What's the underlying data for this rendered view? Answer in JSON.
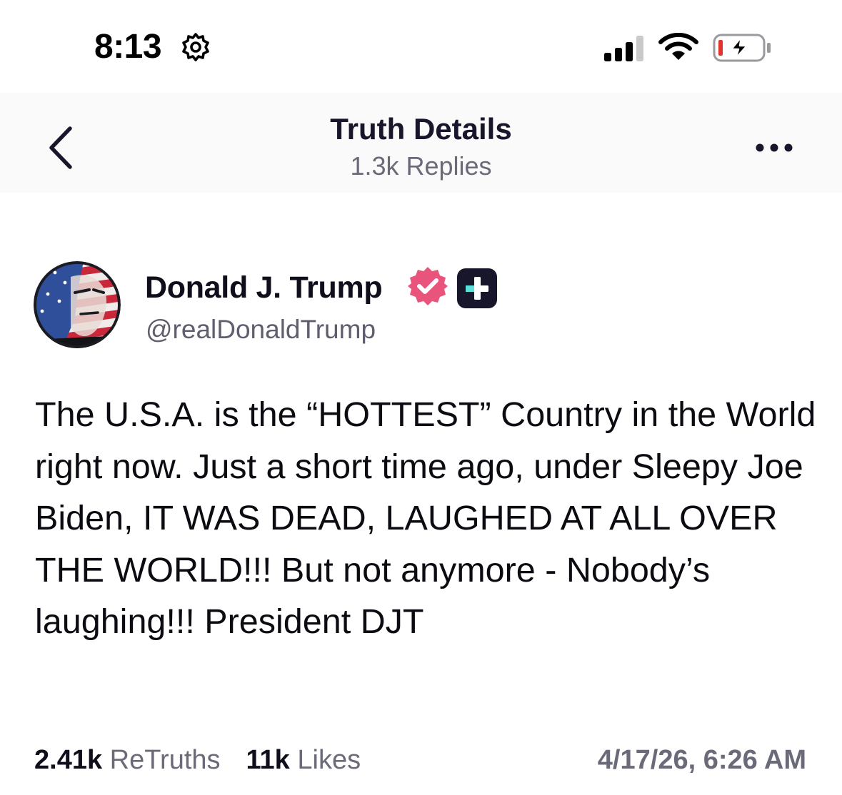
{
  "status_bar": {
    "time": "8:13",
    "focus_icon": "settings-gear-icon",
    "signal_icon": "cellular-signal-icon",
    "wifi_icon": "wifi-icon",
    "battery_icon": "battery-charging-icon"
  },
  "header": {
    "title": "Truth Details",
    "subtitle": "1.3k Replies",
    "back_icon": "chevron-left-icon",
    "more_icon": "more-horizontal-icon"
  },
  "post": {
    "author_name": "Donald J. Trump",
    "author_handle": "@realDonaldTrump",
    "verified_icon": "verified-badge-icon",
    "plus_badge_icon": "plus-badge-icon",
    "text": "The U.S.A. is the “HOTTEST” Country in the World right now. Just a short time ago, under Sleepy Joe Biden, IT WAS DEAD, LAUGHED AT ALL OVER THE WORLD!!! But not anymore - Nobody’s laughing!!! President DJT",
    "retruths_count": "2.41k",
    "retruths_label": "ReTruths",
    "likes_count": "11k",
    "likes_label": "Likes",
    "timestamp": "4/17/26, 6:26 AM"
  },
  "colors": {
    "verified_badge": "#e8547c",
    "plus_badge_bg": "#17162a",
    "plus_badge_accent": "#5ce0d8",
    "muted_text": "#6a6a78",
    "header_bg": "#fafafa"
  }
}
